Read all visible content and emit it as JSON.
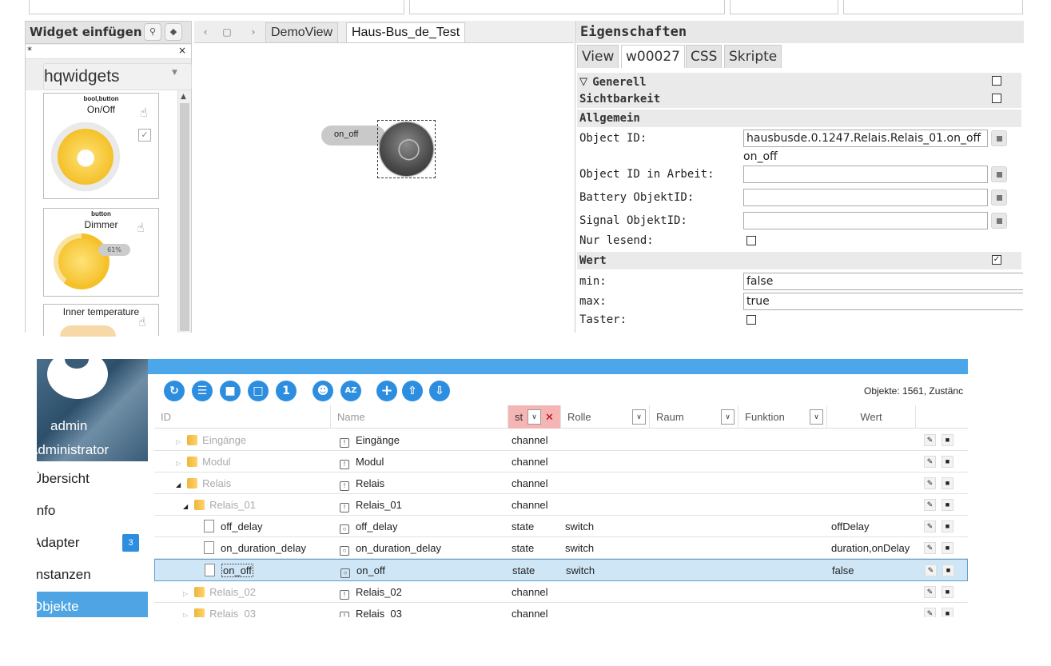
{
  "vis_editor": {
    "left_panel": {
      "title": "Widget einfügen",
      "filter_value": "*",
      "filter_clear": "×",
      "widget_set": "hqwidgets",
      "widgets": [
        {
          "type": "bool,button",
          "name": "On/Off"
        },
        {
          "type": "button",
          "name": "Dimmer",
          "percent": "61%"
        },
        {
          "type": "",
          "name": "Inner temperature"
        }
      ]
    },
    "view_tabs": [
      "DemoView",
      "Haus-Bus_de_Test"
    ],
    "active_view": "Haus-Bus_de_Test",
    "canvas_widget_label": "on_off",
    "properties": {
      "title": "Eigenschaften",
      "tabs": [
        "View",
        "w00027",
        "CSS",
        "Skripte"
      ],
      "active_tab": "w00027",
      "groups": {
        "generell": "Generell",
        "sichtbarkeit": "Sichtbarkeit",
        "allgemein": "Allgemein",
        "wert": "Wert"
      },
      "object_id_label": "Object ID:",
      "object_id_value": "hausbusde.0.1247.Relais.Relais_01.on_off",
      "object_id_hint": "on_off",
      "object_id_arbeit_label": "Object ID in Arbeit:",
      "battery_label": "Battery ObjektID:",
      "signal_label": "Signal ObjektID:",
      "nur_lesend_label": "Nur lesend:",
      "min_label": "min:",
      "min_value": "false",
      "max_label": "max:",
      "max_value": "true",
      "taster_label": "Taster:"
    }
  },
  "admin": {
    "user": {
      "name": "admin",
      "role": "Administrator"
    },
    "nav": [
      {
        "label": "Übersicht",
        "active": false
      },
      {
        "label": "Info",
        "active": false
      },
      {
        "label": "Adapter",
        "badge": "3",
        "active": false
      },
      {
        "label": "Instanzen",
        "active": false
      },
      {
        "label": "Objekte",
        "active": true
      }
    ],
    "toolbar_icons": [
      "refresh-icon",
      "list-icon",
      "folder-icon",
      "folder-open-icon",
      "info-icon",
      "expert-icon",
      "sort-az-icon",
      "add-icon",
      "upload-icon",
      "download-icon"
    ],
    "toolbar_labels": {
      "info": "1",
      "sort": "AZ",
      "add": "+"
    },
    "objects_count": "Objekte: 1561, Zustänc",
    "columns": {
      "id": "ID",
      "name": "Name",
      "type": "st",
      "role": "Rolle",
      "room": "Raum",
      "function": "Funktion",
      "value": "Wert"
    },
    "rows": [
      {
        "id": "Eingänge",
        "name": "Eingänge",
        "type": "channel",
        "role": "",
        "value": ""
      },
      {
        "id": "Modul",
        "name": "Modul",
        "type": "channel",
        "role": "",
        "value": ""
      },
      {
        "id": "Relais",
        "name": "Relais",
        "type": "channel",
        "role": "",
        "value": ""
      },
      {
        "id": "Relais_01",
        "name": "Relais_01",
        "type": "channel",
        "role": "",
        "value": ""
      },
      {
        "id": "off_delay",
        "name": "off_delay",
        "type": "state",
        "role": "switch",
        "value": "offDelay"
      },
      {
        "id": "on_duration_delay",
        "name": "on_duration_delay",
        "type": "state",
        "role": "switch",
        "value": "duration,onDelay"
      },
      {
        "id": "on_off",
        "name": "on_off",
        "type": "state",
        "role": "switch",
        "value": "false"
      },
      {
        "id": "Relais_02",
        "name": "Relais_02",
        "type": "channel",
        "role": "",
        "value": ""
      },
      {
        "id": "Relais_03",
        "name": "Relais_03",
        "type": "channel",
        "role": "",
        "value": ""
      }
    ]
  },
  "colors": {
    "accent": "#4ba7ea",
    "nav_active": "#4fa5e3",
    "toolbar_button": "#2d8ee0",
    "filter_active": "#f5b5b5",
    "selected_row": "#cfe6f6"
  }
}
